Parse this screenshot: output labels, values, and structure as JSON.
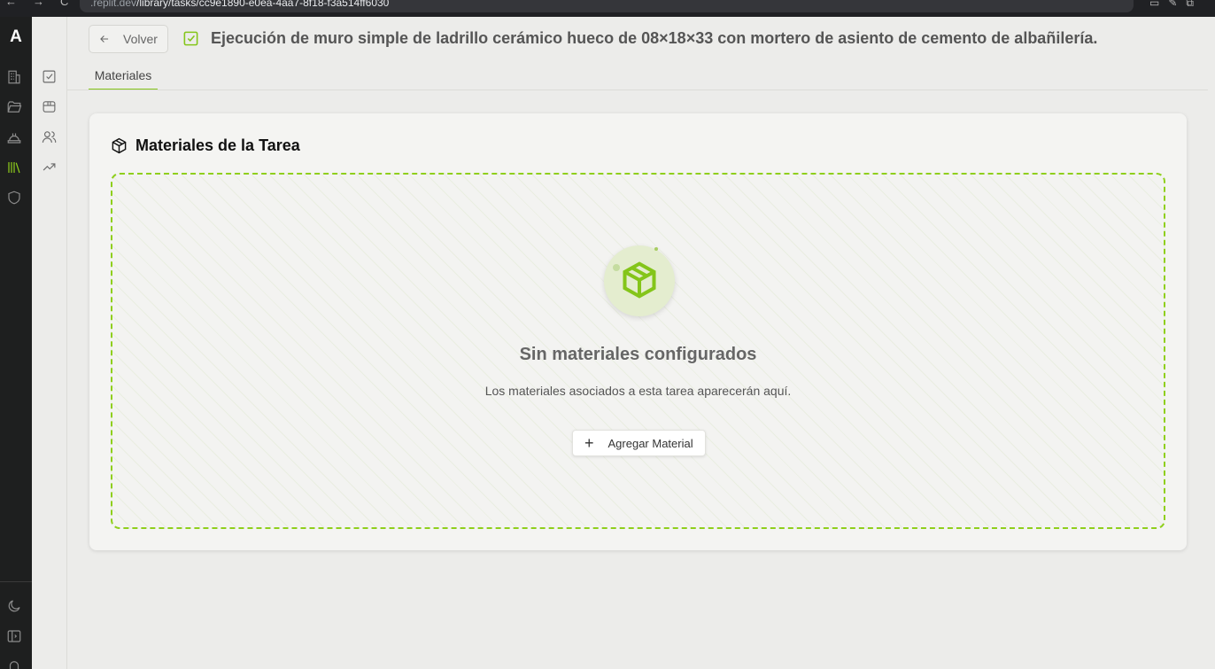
{
  "browser": {
    "url_prefix": ".replit.dev",
    "url_path": "/library/tasks/cc9e1890-e0ea-4aa7-8f18-f3a514ff6030"
  },
  "rail": {
    "logo": "A",
    "icons": [
      "building-icon",
      "folder-icon",
      "helmet-icon",
      "library-icon",
      "shield-icon",
      "moon-icon",
      "panel-toggle-icon"
    ],
    "active_icon": "library-icon",
    "accent_color": "#8fcf1c"
  },
  "sidebar": {
    "icons": [
      "checkbox-icon",
      "box-icon",
      "users-icon",
      "trending-icon"
    ]
  },
  "header": {
    "back_label": "Volver",
    "title": "Ejecución de muro simple de ladrillo cerámico hueco de 08×18×33 con mortero de asiento de cemento de albañilería."
  },
  "tabs": [
    {
      "label": "Materiales",
      "active": true
    }
  ],
  "card": {
    "title": "Materiales de la Tarea",
    "empty_title": "Sin materiales configurados",
    "empty_subtitle": "Los materiales asociados a esta tarea aparecerán aquí.",
    "add_button_label": "Agregar Material"
  }
}
